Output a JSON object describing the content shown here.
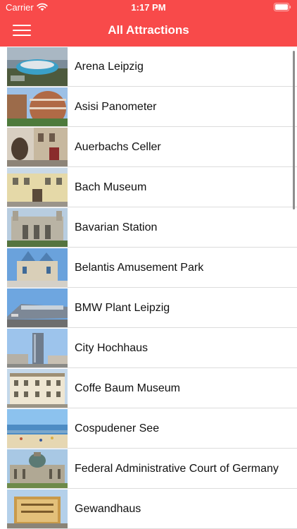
{
  "status": {
    "carrier": "Carrier",
    "time": "1:17 PM"
  },
  "nav": {
    "title": "All Attractions",
    "menu_icon": "hamburger-menu-icon"
  },
  "colors": {
    "header": "#f84a4a",
    "separator": "#dcdcdc"
  },
  "attractions": [
    {
      "name": "Arena Leipzig"
    },
    {
      "name": "Asisi Panometer"
    },
    {
      "name": "Auerbachs Celler"
    },
    {
      "name": "Bach Museum"
    },
    {
      "name": "Bavarian Station"
    },
    {
      "name": "Belantis Amusement Park"
    },
    {
      "name": "BMW Plant Leipzig"
    },
    {
      "name": "City Hochhaus"
    },
    {
      "name": "Coffe Baum Museum"
    },
    {
      "name": "Cospudener See"
    },
    {
      "name": "Federal Administrative Court of Germany"
    },
    {
      "name": "Gewandhaus"
    }
  ]
}
